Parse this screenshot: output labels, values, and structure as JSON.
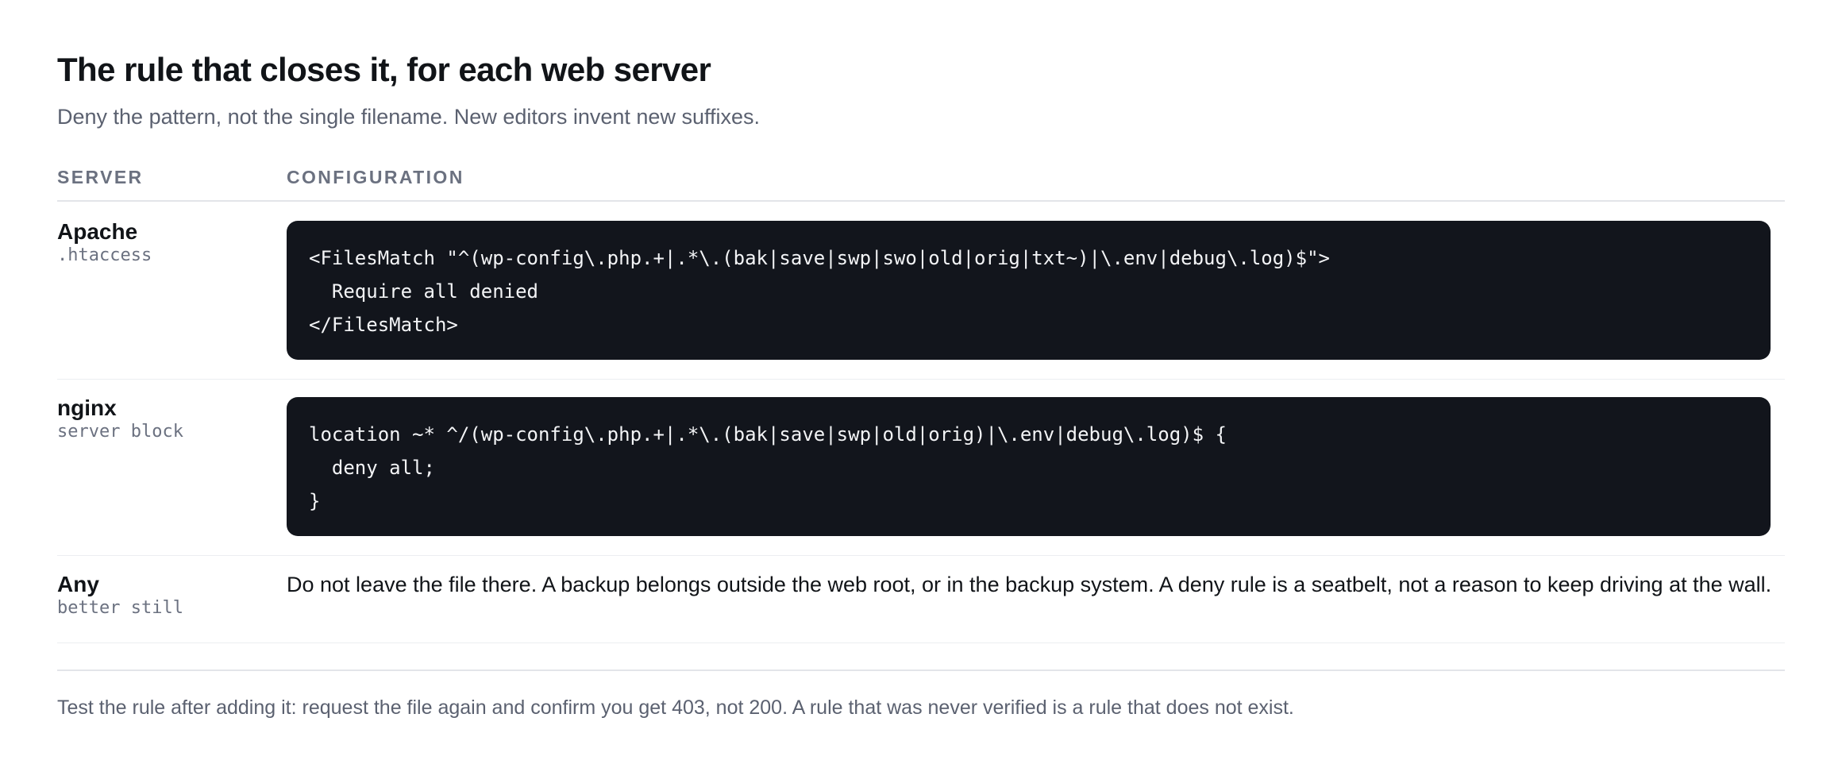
{
  "heading": {
    "title": "The rule that closes it, for each web server",
    "subtitle": "Deny the pattern, not the single filename. New editors invent new suffixes."
  },
  "table": {
    "columns": [
      "SERVER",
      "CONFIGURATION"
    ],
    "rows": [
      {
        "server": "Apache",
        "context": ".htaccess",
        "code": [
          "<FilesMatch \"^(wp-config\\.php.+|.*\\.(bak|save|swp|swo|old|orig|txt~)|\\.env|debug\\.log)$\">",
          "  Require all denied",
          "</FilesMatch>"
        ]
      },
      {
        "server": "nginx",
        "context": "server block",
        "code": [
          "location ~* ^/(wp-config\\.php.+|.*\\.(bak|save|swp|old|orig)|\\.env|debug\\.log)$ {",
          "  deny all;",
          "}"
        ]
      },
      {
        "server": "Any",
        "context": "better still",
        "text": "Do not leave the file there. A backup belongs outside the web root, or in the backup system. A deny rule is a seatbelt, not a reason to keep driving at the wall."
      }
    ]
  },
  "footer": {
    "note": "Test the rule after adding it: request the file again and confirm you get 403, not 200. A rule that was never verified is a rule that does not exist."
  },
  "colors": {
    "code_background": "#12151c",
    "heading_text": "#111418",
    "muted_text": "#5b6170",
    "rule_line": "#e3e5e9"
  }
}
